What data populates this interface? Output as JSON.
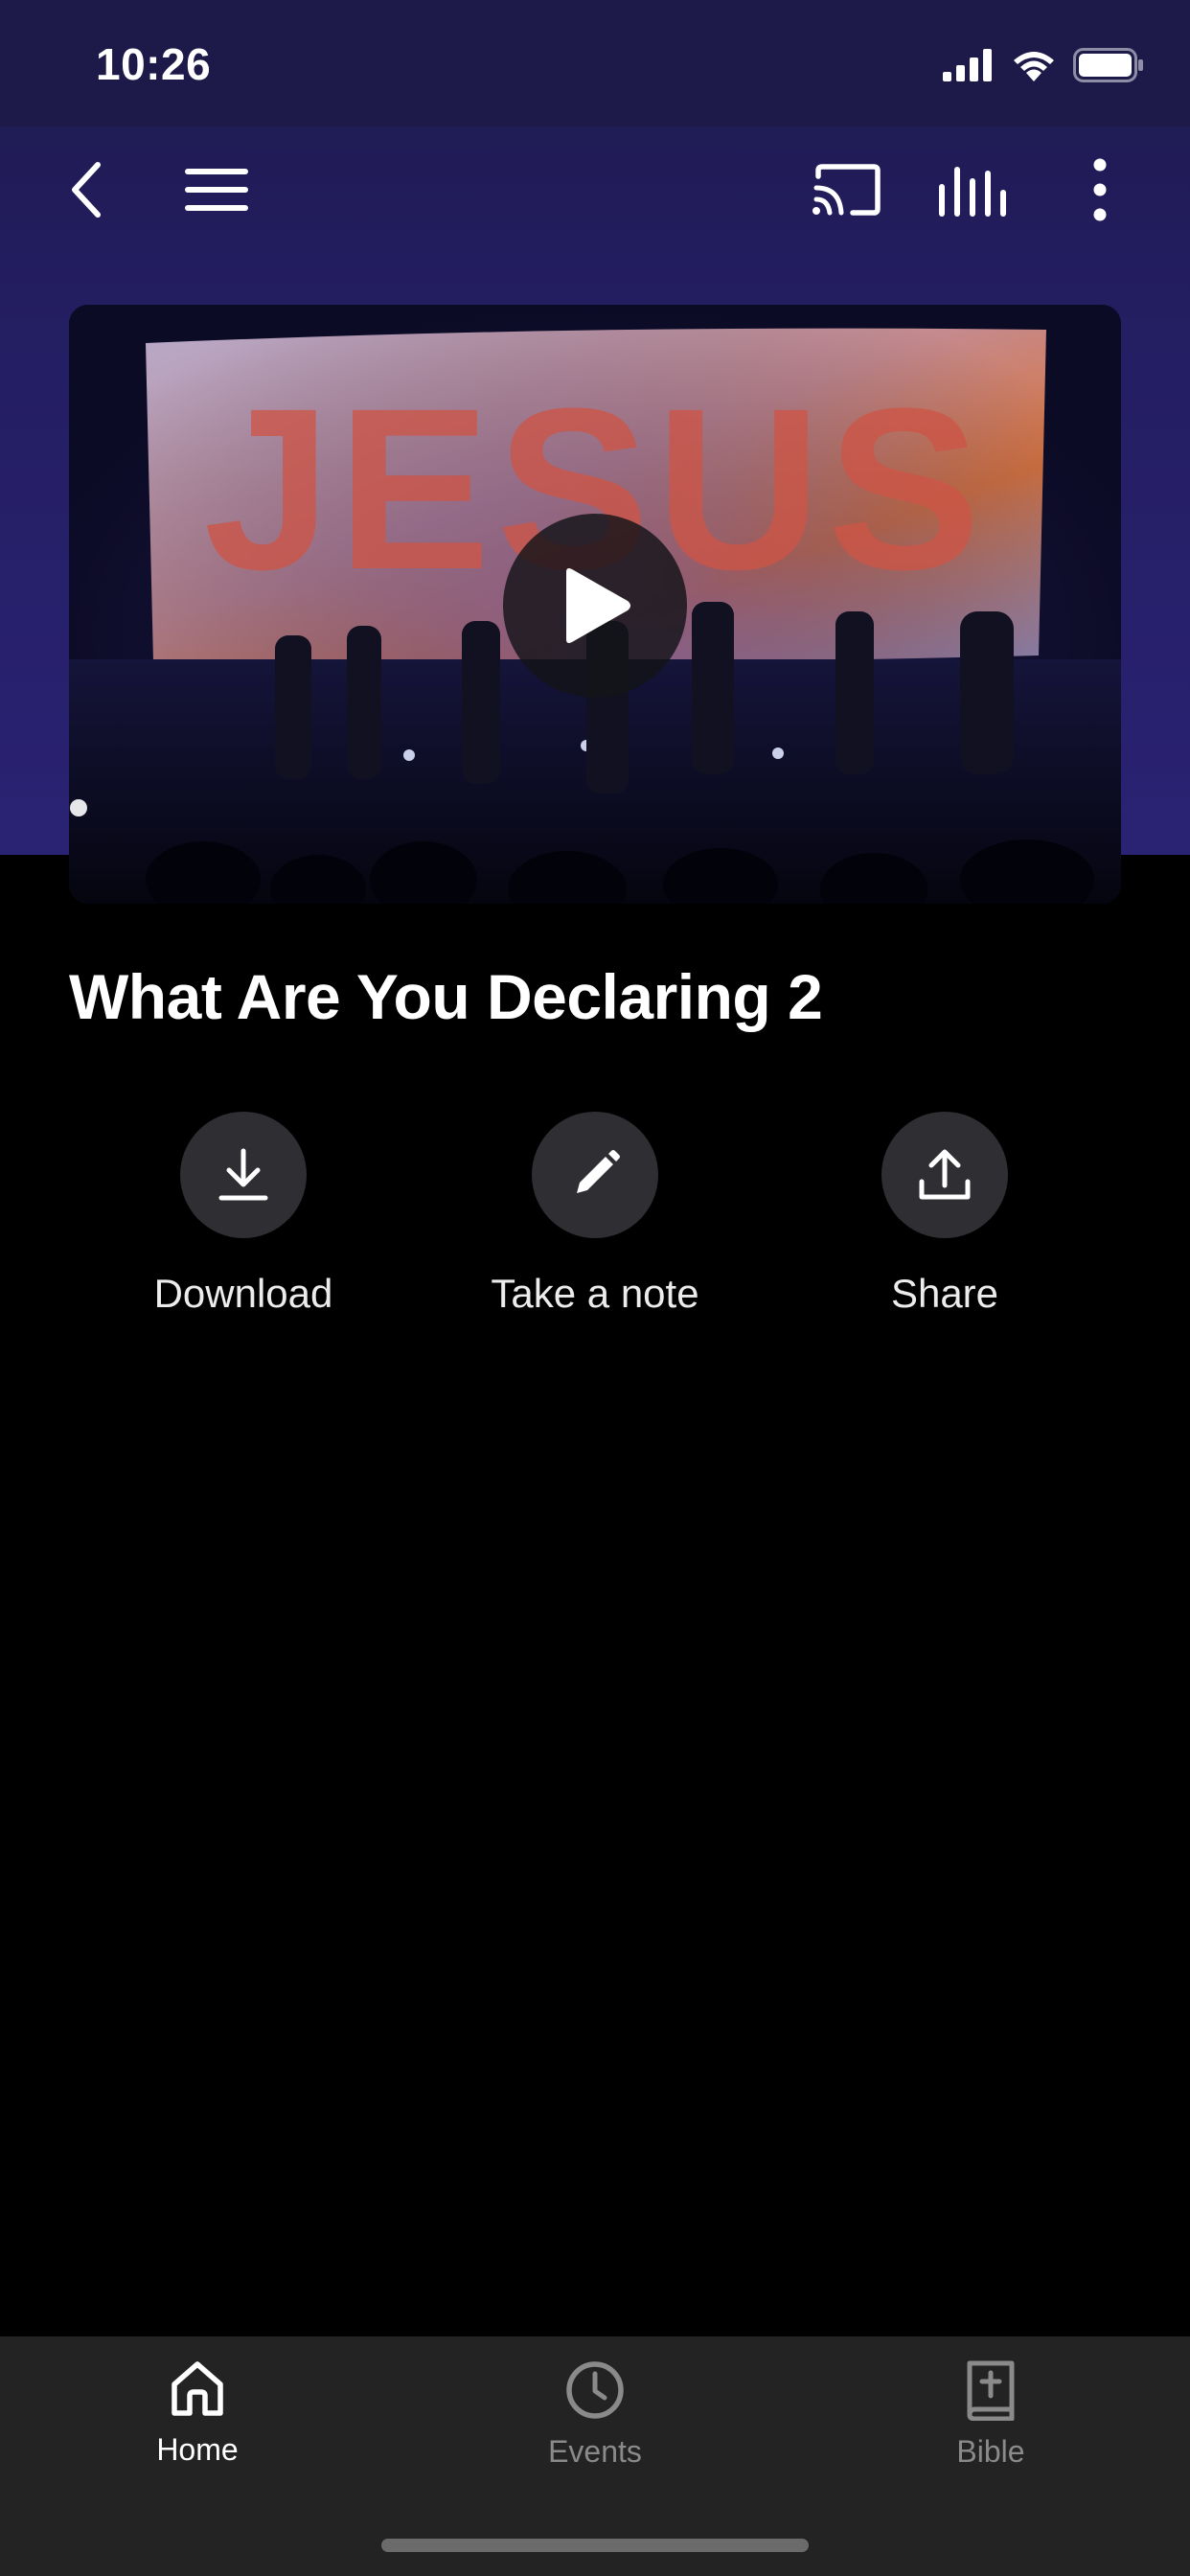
{
  "status_bar": {
    "time": "10:26"
  },
  "toolbar": {
    "icons": [
      "back-icon",
      "menu-icon",
      "cast-icon",
      "equalizer-icon",
      "more-vertical-icon"
    ]
  },
  "video": {
    "banner_text": "JESUS",
    "play_icon": "play-icon"
  },
  "content": {
    "title": "What Are You Declaring 2"
  },
  "actions": [
    {
      "label": "Download",
      "icon": "download-icon"
    },
    {
      "label": "Take a note",
      "icon": "pencil-icon"
    },
    {
      "label": "Share",
      "icon": "share-icon"
    }
  ],
  "tab_bar": {
    "tabs": [
      {
        "label": "Home",
        "icon": "home-icon",
        "active": true
      },
      {
        "label": "Events",
        "icon": "clock-icon",
        "active": false
      },
      {
        "label": "Bible",
        "icon": "bible-icon",
        "active": false
      }
    ]
  },
  "colors": {
    "header_bg": "#241e63",
    "background": "#000000",
    "tab_bar_bg": "#232323",
    "action_circle": "#2f2f33",
    "inactive_tab": "#8a8a8a"
  }
}
